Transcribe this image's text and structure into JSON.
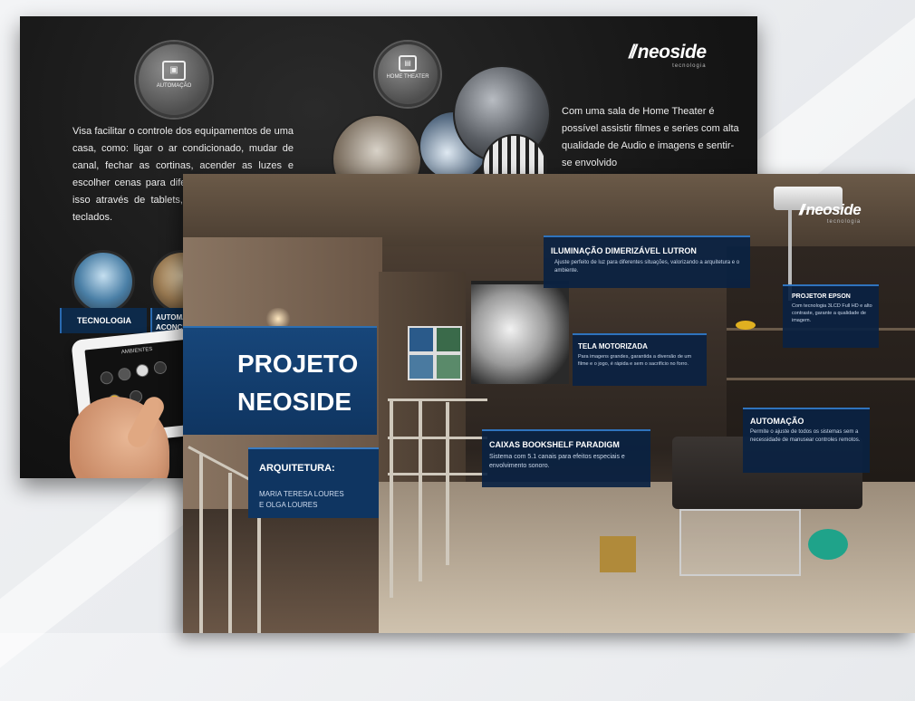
{
  "back_brochure": {
    "logo": {
      "mark": "//",
      "text": "neoside",
      "tagline": "tecnologia"
    },
    "icon_automacao_label": "AUTOMAÇÃO",
    "icon_home_theater_label": "HOME THEATER",
    "left_text": "Visa facilitar o controle dos equipamentos de uma casa, como: ligar o ar condicionado, mudar de canal, fechar as cortinas, acender as luzes e escolher cenas para diferentes ambientes. Tudo isso através de tablets, celulares ou painéis e teclados.",
    "right_text": "Com uma sala de Home Theater é possível assistir filmes e series com alta qualidade de Audio e imagens e sentir-se envolvido",
    "feature_1": "TECNOLOGIA",
    "feature_2": "AUTOMAÇÃO ACONCHEGANTE",
    "tablet_app_title": "AMBIENTES"
  },
  "front_brochure": {
    "logo": {
      "mark": "//",
      "text": "neoside",
      "tagline": "tecnologia"
    },
    "title_line1": "PROJETO",
    "title_line2": "NEOSIDE",
    "architecture": {
      "heading_line1": "ARQUITETURA:",
      "names_line1": "MARIA TERESA LOURES",
      "names_line2": "E OLGA LOURES"
    },
    "callouts": [
      {
        "heading": "ILUMINAÇÃO DIMERIZÁVEL LUTRON",
        "text": "Ajuste perfeito de luz para diferentes situações, valorizando a arquitetura e o ambiente."
      },
      {
        "heading": "TELA MOTORIZADA",
        "text": "Para imagens grandes, garantida a diversão de um filme e o jogo, é rápida e sem o sacrifício no forro."
      },
      {
        "heading": "PROJETOR EPSON",
        "text": "Com tecnologia 3LCD Full HD e alto contraste, garante a qualidade de imagem."
      },
      {
        "heading": "CAIXAS BOOKSHELF PARADIGM",
        "text": "Sistema com 5.1 canais para efeitos especiais e envolvimento sonoro."
      },
      {
        "heading": "AUTOMAÇÃO",
        "text": "Permite o ajuste de todos os sistemas sem a necessidade de manusear controles remotos."
      }
    ]
  }
}
